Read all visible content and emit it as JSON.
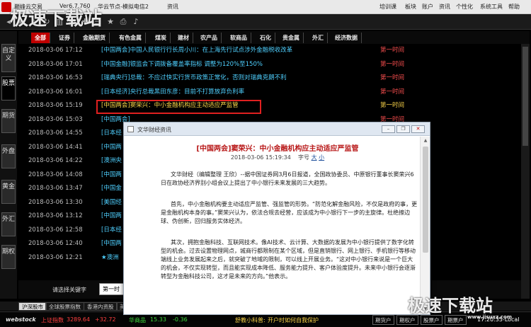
{
  "titlebar": {
    "app_name": "巅峰云交易",
    "version": "Ver6.7.760",
    "server": "华云节点-模拟电信2",
    "menu_info": "资讯",
    "menu_items": [
      "培训课",
      "板块",
      "账户",
      "资讯",
      "个性化",
      "系统工具",
      "帮助"
    ]
  },
  "categories": [
    "全部",
    "证券",
    "金融期货",
    "有色金属",
    "煤炭",
    "建材",
    "农产品",
    "软商品",
    "石化",
    "贵金属",
    "外汇",
    "经济数据"
  ],
  "vtabs": [
    "自定义",
    "股票",
    "期货",
    "外盘",
    "黄金",
    "外汇",
    "期权"
  ],
  "news": [
    {
      "date": "2018-03-06 17:12",
      "headline": "[中国两会]中国人民银行行长周小川：在上海先行试点涉外金融税收改革",
      "source": "第一时间"
    },
    {
      "date": "2018-03-06 17:01",
      "headline": "[中国金融]银监会下调拨备覆盖率指标 调整为120%至150%",
      "source": "第一时间"
    },
    {
      "date": "2018-03-06 16:53",
      "headline": "[瑞典央行]总裁：不应过快实行货币政策正常化，否则对瑞典克朗不利",
      "source": "第一时间"
    },
    {
      "date": "2018-03-06 16:01",
      "headline": "[日本经济]央行总裁黑田东彦：目前不打算放弃负利率",
      "source": "第一时间"
    },
    {
      "date": "2018-03-06 15:19",
      "headline": "[中国两会]窦荣兴：中小金融机构应主动适应严监管",
      "source": "第一时间"
    },
    {
      "date": "2018-03-06 15:03",
      "headline": "[中国两会]",
      "source": "第一时间"
    },
    {
      "date": "2018-03-06 14:55",
      "headline": "[日本经",
      "source": "第一时间"
    },
    {
      "date": "2018-03-06 14:41",
      "headline": "[中国两",
      "source": "第一时间"
    },
    {
      "date": "2018-03-06 14:22",
      "headline": "[澳洲央",
      "source": "第一时间"
    },
    {
      "date": "2018-03-06 14:08",
      "headline": "[中国两",
      "source": "第一时间"
    },
    {
      "date": "2018-03-06 13:47",
      "headline": "[中国金",
      "source": "第一时间"
    },
    {
      "date": "2018-03-06 13:30",
      "headline": "[美国经",
      "source": "第一时间"
    },
    {
      "date": "2018-03-06 13:12",
      "headline": "[中国两",
      "source": "第一时间"
    },
    {
      "date": "2018-03-06 12:58",
      "headline": "[日本经",
      "source": "第一时间"
    },
    {
      "date": "2018-03-06 12:40",
      "headline": "[中国两",
      "source": "第一时间"
    },
    {
      "date": "2018-03-06 12:21",
      "headline": "★澳洲",
      "source": "第一时间"
    }
  ],
  "search": {
    "label": "请选择关键字",
    "value": "第一时"
  },
  "bottom_tabs": [
    "沪深股市",
    "全球股票指数",
    "香港内资股",
    "美"
  ],
  "status": {
    "brand": "webstock",
    "index_name": "上证指数",
    "index_value": "3289.64",
    "index_change": "+32.72",
    "commodity_name": "华商品",
    "commodity_value": "15.33",
    "commodity_change": "-0.36",
    "ticker_prefix": "舒教小科普:",
    "ticker_text": "开户时如何自我保护",
    "buttons": [
      "期货户",
      "期权户",
      "股票户",
      "期票户"
    ],
    "clock": "17:20:35-Local"
  },
  "popup": {
    "window_title": "文华财经资讯",
    "headline": "[中国两会]窦荣兴：中小金融机构应主动适应严监管",
    "datetime": "2018-03-06 15:19:34",
    "font_label": "字号",
    "font_large": "大",
    "font_small": "小",
    "paragraphs": [
      "文华财经（编辑整理 王欣）--据中国证券网3月6日报道，全国政协委员、中原银行董事长窦荣兴6日在政协经济界别小组会议上提出了中小银行未来发展的三大趋势。",
      "首先，中小金融机构要主动适应严监管、强监管的形势。“防范化解金融风险，不仅是政府的事，更是金融机构本身的事。”窦荣兴认为，依法合规去经营，应该成为中小银行下一步的主旋律。杜绝擦边球、伪创新，回归服务实体经济。",
      "其次，拥抱金融科技、互联网技术。像AI技术、云计算、大数据的发展为中小银行提供了数字化转型的机会。过去设置物理网点，城商行都限制在某个区域，但是直销银行、网上银行、手机银行等移动端线上业务发展起来之后，就突破了地域的限制，可以线上开展业务。“这对中小银行来说是一个巨大的机会，不仅实现转型，而且能实现成本降低、服务能力提升、客户体验度提升。未来中小银行会逐渐转型为金融科技公司，这才是未来的方向。”他表示。"
    ]
  },
  "watermark": {
    "top_left": "极速下载站",
    "bottom_right": "极速下载站",
    "url": "www.jisuxz.com"
  }
}
